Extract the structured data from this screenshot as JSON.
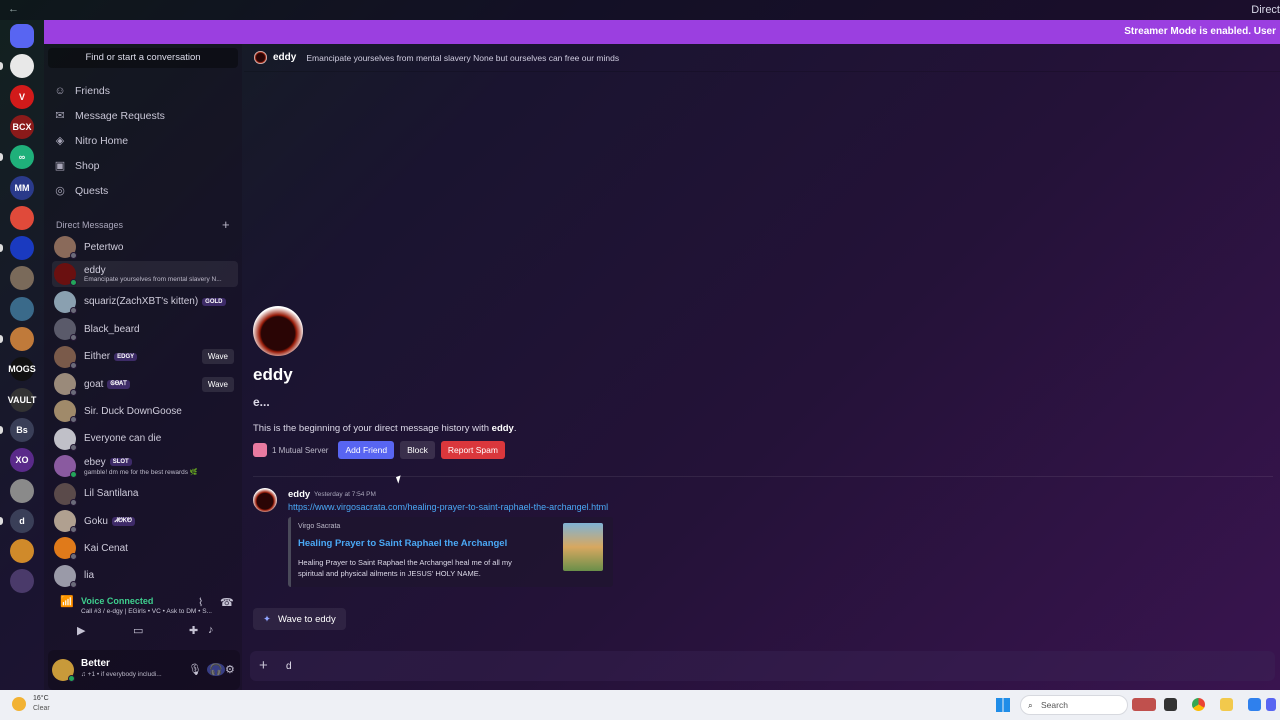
{
  "window": {
    "title": "Direct",
    "nav_back": "←",
    "nav_forward": "→"
  },
  "streamer_banner": "Streamer Mode is enabled. User",
  "server_rail": [
    {
      "label": "",
      "icon": "discord-home-icon",
      "color": "#5865f2"
    },
    {
      "label": "",
      "color": "#e8e8e8"
    },
    {
      "label": "V",
      "color": "#d21a1a"
    },
    {
      "label": "BCX",
      "color": "#8a1a1a"
    },
    {
      "label": "∞",
      "color": "#1fb07a"
    },
    {
      "label": "MM",
      "color": "#2a3a8a"
    },
    {
      "label": "",
      "color": "#e04a3a"
    },
    {
      "label": "",
      "color": "#1a3ac0"
    },
    {
      "label": "",
      "color": "#7a6a5a"
    },
    {
      "label": "",
      "color": "#3a6a8a"
    },
    {
      "label": "",
      "color": "#c07a3a"
    },
    {
      "label": "MOGS",
      "color": "#111111"
    },
    {
      "label": "VAULT",
      "color": "#333333"
    },
    {
      "label": "Bs",
      "color": "#3a3f58"
    },
    {
      "label": "XO",
      "color": "#5a2a8a"
    },
    {
      "label": "",
      "color": "#8a8a8a"
    },
    {
      "label": "d",
      "color": "#3a3f58"
    },
    {
      "label": "",
      "color": "#d08a2a"
    },
    {
      "label": "",
      "color": "#4a3a6a"
    }
  ],
  "sidebar": {
    "search_label": "Find or start a conversation",
    "nav": [
      {
        "label": "Friends",
        "icon": "friends-icon",
        "glyph": "☺"
      },
      {
        "label": "Message Requests",
        "icon": "envelope-icon",
        "glyph": "✉"
      },
      {
        "label": "Nitro Home",
        "icon": "nitro-icon",
        "glyph": "◈"
      },
      {
        "label": "Shop",
        "icon": "shop-icon",
        "glyph": "▣"
      },
      {
        "label": "Quests",
        "icon": "quests-icon",
        "glyph": "◎"
      }
    ],
    "dm_header": "Direct Messages",
    "dm_add": "+",
    "dms": [
      {
        "name": "Petertwo",
        "sub": "",
        "tag": "",
        "wave": "",
        "color": "#8a6a5a",
        "online": false,
        "active": false
      },
      {
        "name": "eddy",
        "sub": "Emancipate yourselves from mental slavery N...",
        "tag": "",
        "wave": "",
        "color": "#6a1010",
        "online": true,
        "active": true
      },
      {
        "name": "squariz(ZachXBT's kitten)",
        "sub": "",
        "tag": "GOLD",
        "wave": "",
        "color": "#8aa0b0",
        "online": false,
        "active": false
      },
      {
        "name": "Black_beard",
        "sub": "",
        "tag": "",
        "wave": "",
        "color": "#5a5a6a",
        "online": false,
        "active": false
      },
      {
        "name": "Either",
        "sub": "",
        "tag": "EDGY",
        "wave": "Wave",
        "color": "#7a5a4a",
        "online": false,
        "active": false
      },
      {
        "name": "goat",
        "sub": "",
        "tag": "ᎶᎾᎪᎢ",
        "wave": "Wave",
        "color": "#9a8a7a",
        "online": false,
        "active": false
      },
      {
        "name": "Sir. Duck DownGoose",
        "sub": "",
        "tag": "",
        "wave": "",
        "color": "#a08a6a",
        "online": false,
        "active": false
      },
      {
        "name": "Everyone can die",
        "sub": "",
        "tag": "",
        "wave": "",
        "color": "#c0c0c8",
        "online": false,
        "active": false
      },
      {
        "name": "ebey",
        "sub": "gamble! dm me for the best rewards 🌿",
        "tag": "SLOT",
        "wave": "",
        "color": "#8a5aa0",
        "online": true,
        "active": false
      },
      {
        "name": "Lil Santilana",
        "sub": "",
        "tag": "",
        "wave": "",
        "color": "#5a4a4a",
        "online": false,
        "active": false
      },
      {
        "name": "Goku",
        "sub": "",
        "tag": "ᏗᏬᏦᏬ",
        "wave": "",
        "color": "#b0a090",
        "online": false,
        "active": false
      },
      {
        "name": "Kai Cenat",
        "sub": "",
        "tag": "",
        "wave": "",
        "color": "#e07a1a",
        "online": false,
        "active": false
      },
      {
        "name": "lia",
        "sub": "",
        "tag": "",
        "wave": "",
        "color": "#9a9aa8",
        "online": false,
        "active": false
      }
    ],
    "voice": {
      "title": "Voice Connected",
      "sub": "Call #3 / e-dgy | EGirls • VC • Ask to DM • S...",
      "actions": [
        "video-icon",
        "screen-share-icon",
        "activities-icon",
        "soundboard-icon"
      ]
    },
    "user": {
      "name": "Better",
      "sub": "♫ +1 • if everybody includi..."
    }
  },
  "chat": {
    "header_name": "eddy",
    "header_status": "Emancipate yourselves from mental slavery None but ourselves can free our minds",
    "intro_name": "eddy",
    "intro_username": "e...",
    "intro_text_prefix": "This is the beginning of your direct message history with ",
    "intro_text_name": "eddy",
    "intro_text_suffix": ".",
    "mutual": "1 Mutual Server",
    "add_friend": "Add Friend",
    "block": "Block",
    "report_spam": "Report Spam",
    "message": {
      "author": "eddy",
      "time": "Yesterday at 7:54 PM",
      "link": "https://www.virgosacrata.com/healing-prayer-to-saint-raphael-the-archangel.html",
      "embed": {
        "site": "Virgo Sacrata",
        "title": "Healing Prayer to Saint Raphael the Archangel",
        "description": "Healing Prayer to Saint Raphael the Archangel heal me of all my spiritual and physical ailments in JESUS' HOLY NAME."
      }
    },
    "wave_button": "Wave to eddy",
    "composer_value": "d",
    "composer_plus": "+"
  },
  "taskbar": {
    "temp": "16°C",
    "weather": "Clear",
    "search": "Search"
  }
}
